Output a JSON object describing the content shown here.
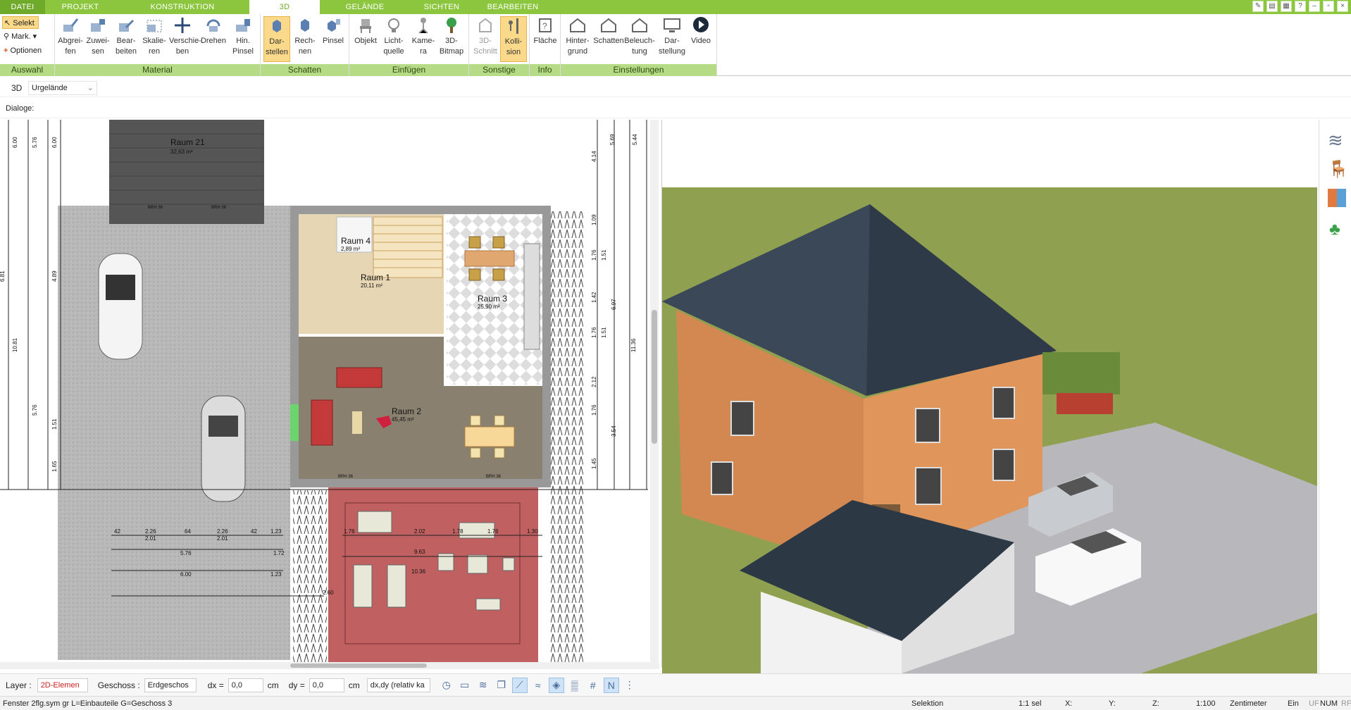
{
  "tabs": [
    "DATEI",
    "PROJEKT",
    "KONSTRUKTION",
    "3D",
    "GELÄNDE",
    "SICHTEN",
    "BEARBEITEN"
  ],
  "window_controls": [
    "–",
    "▫",
    "×"
  ],
  "ribbon": {
    "auswahl": {
      "label": "Auswahl",
      "select": "Selekt",
      "mark": "Mark.",
      "options": "Optionen"
    },
    "material": {
      "label": "Material",
      "buttons": [
        "Abgrei-\nfen",
        "Zuwei-\nsen",
        "Bear-\nbeiten",
        "Skalie-\nren",
        "Verschie-\nben",
        "Drehen",
        "Hin.\nPinsel"
      ]
    },
    "schatten": {
      "label": "Schatten",
      "buttons": [
        "Dar-\nstellen",
        "Rech-\nnen",
        "Pinsel"
      ]
    },
    "einfuegen": {
      "label": "Einfügen",
      "buttons": [
        "Objekt",
        "Licht-\nquelle",
        "Kame-\nra",
        "3D-\nBitmap"
      ]
    },
    "sonstige": {
      "label": "Sonstige",
      "buttons": [
        "3D-\nSchnitt",
        "Kolli-\nsion"
      ]
    },
    "info": {
      "label": "Info",
      "buttons": [
        "Fläche"
      ]
    },
    "einstellungen": {
      "label": "Einstellungen",
      "buttons": [
        "Hinter-\ngrund",
        "Schatten",
        "Beleuch-\ntung",
        "Dar-\nstellung",
        "Video"
      ]
    }
  },
  "viewbar": {
    "mode": "3D",
    "terrain": "Urgelände"
  },
  "dialogbar": {
    "label": "Dialoge:"
  },
  "plan": {
    "rooms": [
      {
        "name": "Raum 21",
        "area": "32,63 m²"
      },
      {
        "name": "Raum 4",
        "area": "2,89 m²"
      },
      {
        "name": "Raum 1",
        "area": "20,11 m²"
      },
      {
        "name": "Raum 3",
        "area": "25,90 m²"
      },
      {
        "name": "Raum 2",
        "area": "45,45 m²"
      }
    ],
    "dims_top": [
      "6.00",
      "5.76",
      "6.00"
    ],
    "dims_left": [
      "4.89",
      "10.81",
      "5.76",
      "6.81",
      "1.51",
      "1.65"
    ],
    "dims_right": [
      "4.14",
      "5.69",
      "5.44",
      "1.09",
      "1.76",
      "1.51",
      "1.42",
      "6.97",
      "1.76",
      "11.36",
      "2.12",
      "1.76",
      "3.54",
      "1.45",
      "1.51"
    ],
    "dims_bottom_row1": [
      "42",
      "2.26",
      "64",
      "2.26",
      "42",
      "1.23"
    ],
    "dims_bottom_row2": [
      "2.01",
      "2.01"
    ],
    "dims_bottom_row3": [
      "5.76",
      "1.72"
    ],
    "dims_bottom_row4": [
      "6.00",
      "1.23"
    ],
    "dims_bottom_row5": [
      "2.60"
    ],
    "dims_patio": [
      "1.76",
      "2.02",
      "1.78",
      "1.76",
      "1.30",
      "9.63",
      "10.36"
    ],
    "window_labels": [
      "BRH 36",
      "BRH 36",
      "BRH 36",
      "BRH 36"
    ]
  },
  "toolbar": {
    "layer_label": "Layer :",
    "layer_value": "2D-Elemen",
    "floor_label": "Geschoss :",
    "floor_value": "Erdgeschos",
    "dx_label": "dx =",
    "dx_value": "0,0",
    "dx_unit": "cm",
    "dy_label": "dy =",
    "dy_value": "0,0",
    "dy_unit": "cm",
    "rel_value": "dx,dy (relativ ka"
  },
  "status": {
    "file": "Fenster 2flg.sym gr L=Einbauteile G=Geschoss 3",
    "mode": "Selektion",
    "sel": "1:1 sel",
    "x": "X:",
    "y": "Y:",
    "z": "Z:",
    "scale": "1:100",
    "unit": "Zentimeter",
    "ein": "Ein",
    "uf": "UF",
    "num": "NUM",
    "rf": "RF"
  },
  "colors": {
    "accent": "#8cc63f",
    "ribbon_group": "#b6db86",
    "active_btn": "#fbd98a"
  }
}
